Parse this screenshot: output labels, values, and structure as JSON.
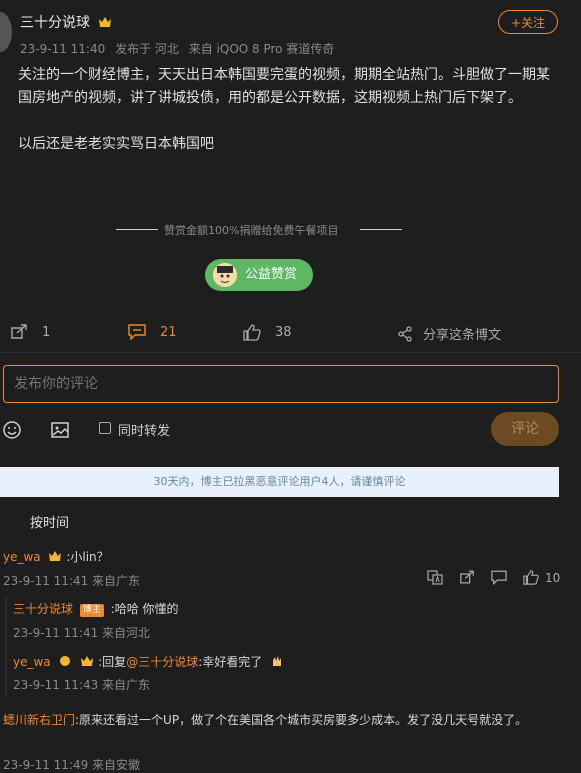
{
  "post": {
    "author": "三十分说球",
    "follow_label": "+关注",
    "timestamp": "23-9-11 11:40",
    "location": "发布于 河北",
    "device": "来自 iQOO 8 Pro 赛道传奇",
    "paragraph1": "关注的一个财经博主，天天出日本韩国要完蛋的视频，期期全站热门。斗胆做了一期某国房地产的视频，讲了讲城投债，用的都是公开数据，这期视频上热门后下架了。",
    "paragraph2": "以后还是老老实实骂日本韩国吧",
    "reward_notice": "赞赏金额100%捐赠给免费午餐项目",
    "reward_button": "公益赞赏",
    "repost_count": "1",
    "comment_count": "21",
    "like_count": "38",
    "share_label": "分享这条博文"
  },
  "composer": {
    "placeholder": "发布你的评论",
    "repost_label": "同时转发",
    "submit_label": "评论"
  },
  "notice": "30天内，博主已拉黑恶意评论用户4人，请谨慎评论",
  "sort_label": "按时间",
  "comments": [
    {
      "user": "ye_wa",
      "text": ":小lin？",
      "time": "23-9-11 11:41 来自广东",
      "likes": "10",
      "replies": [
        {
          "user": "三十分说球",
          "badge": "博主",
          "text": ":哈哈 你懂的",
          "time": "23-9-11 11:41 来自河北"
        },
        {
          "user": "ye_wa",
          "text_prefix": ":回复",
          "mention": "@三十分说球",
          "text": ":幸好看完了",
          "time": "23-9-11 11:43 来自广东"
        }
      ]
    },
    {
      "user": "蟋川新右卫门",
      "text": ":原来还看过一个UP，做了个在美国各个城市买房要多少成本。发了没几天号就没了。",
      "time": "23-9-11 11:49 来自安徽"
    }
  ],
  "colors": {
    "accent": "#f0882f",
    "background": "#1e1e1e",
    "reward_green": "#5db763",
    "notice_bg": "#e7f0fb"
  }
}
